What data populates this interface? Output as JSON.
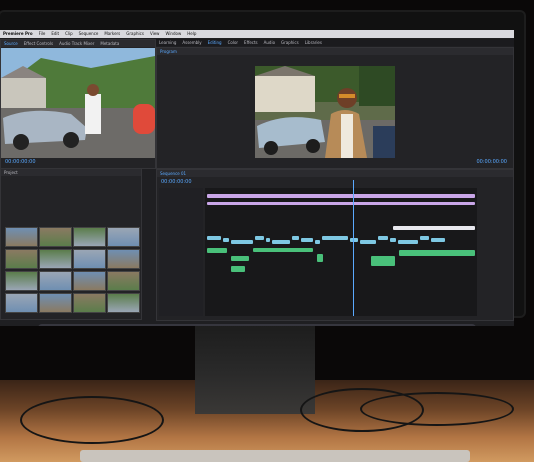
{
  "photo": {
    "subject": "computer monitor showing a video editing application on a desk"
  },
  "screen": {
    "menu_items": [
      "Premiere Pro",
      "File",
      "Edit",
      "Clip",
      "Sequence",
      "Markers",
      "Graphics",
      "View",
      "Window",
      "Help"
    ],
    "workspace_tabs": [
      "Learning",
      "Assembly",
      "Editing",
      "Color",
      "Effects",
      "Audio",
      "Graphics",
      "Libraries"
    ],
    "active_tab": "Editing",
    "source_panel_tabs": [
      "Source",
      "Effect Controls",
      "Audio Track Mixer",
      "Metadata"
    ],
    "program_panel_title": "Program",
    "timecode_left": "00:00:00:00",
    "timecode_right": "00:00:00:00",
    "project_panel_title": "Project",
    "timeline_panel_title": "Sequence 01",
    "timeline_timecode": "00:00:00:00"
  },
  "dock": {
    "icon_names": [
      "finder-icon",
      "launchpad-icon",
      "safari-icon",
      "mail-icon",
      "contacts-icon",
      "calendar-icon",
      "notes-icon",
      "reminders-icon",
      "maps-icon",
      "photos-icon",
      "messages-icon",
      "facetime-icon",
      "music-icon",
      "podcasts-icon",
      "tv-icon",
      "news-icon",
      "numbers-icon",
      "keynote-icon",
      "pages-icon",
      "premiere-icon",
      "lightroom-icon",
      "photoshop-icon",
      "app-store-icon",
      "preferences-icon",
      "terminal-icon",
      "folder-icon",
      "trash-icon"
    ]
  },
  "colors": {
    "video_clip": "#7ec8e3",
    "audio_clip": "#49c07a",
    "title_clip": "#c9a6e8",
    "playhead": "#5aa9ff",
    "lamp_glow": "#d19a60"
  }
}
